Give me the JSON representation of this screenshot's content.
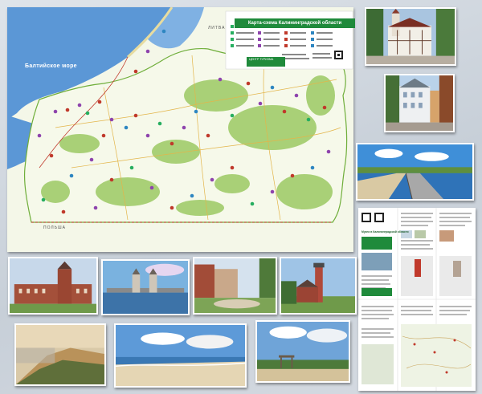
{
  "map": {
    "title": "Карта-схема Калининградской области",
    "sea_label": "Балтийское море",
    "country_north": "ЛИТВА",
    "country_south": "ПОЛЬША",
    "tic_label": "ЦЕНТР ТУРИЗМА",
    "colors": {
      "land": "#f4f7e8",
      "forest": "#a9d077",
      "sea": "#5b97d6",
      "route": "#c0392b"
    }
  },
  "brochure": {
    "title": "Музеи в Калининградской области"
  },
  "photos": [
    {
      "name": "photo-timbered-tower-street"
    },
    {
      "name": "photo-old-town-street"
    },
    {
      "name": "photo-curonian-boardwalk"
    },
    {
      "name": "photo-red-brick-building"
    },
    {
      "name": "photo-bridge-towers"
    },
    {
      "name": "photo-town-square"
    },
    {
      "name": "photo-lighthouse"
    },
    {
      "name": "photo-curonian-dune"
    },
    {
      "name": "photo-sandy-beach"
    },
    {
      "name": "photo-observation-tower"
    }
  ]
}
